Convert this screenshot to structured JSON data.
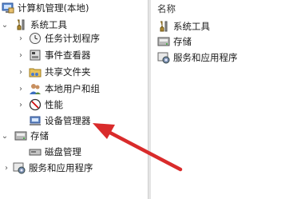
{
  "tree": {
    "root_label": "计算机管理(本地)",
    "items": [
      {
        "label": "系统工具",
        "icon": "tools-icon",
        "chevron": "expanded"
      },
      {
        "label": "任务计划程序",
        "icon": "clock-icon",
        "chevron": "collapsed"
      },
      {
        "label": "事件查看器",
        "icon": "event-viewer-icon",
        "chevron": "collapsed"
      },
      {
        "label": "共享文件夹",
        "icon": "shared-folder-icon",
        "chevron": "collapsed"
      },
      {
        "label": "本地用户和组",
        "icon": "users-icon",
        "chevron": "collapsed"
      },
      {
        "label": "性能",
        "icon": "performance-icon",
        "chevron": "collapsed"
      },
      {
        "label": "设备管理器",
        "icon": "device-manager-icon",
        "chevron": "none"
      },
      {
        "label": "存储",
        "icon": "storage-icon",
        "chevron": "expanded",
        "selected": true
      },
      {
        "label": "磁盘管理",
        "icon": "disk-icon",
        "chevron": "none"
      },
      {
        "label": "服务和应用程序",
        "icon": "services-icon",
        "chevron": "collapsed"
      }
    ]
  },
  "list": {
    "column_header": "名称",
    "items": [
      {
        "label": "系统工具",
        "icon": "tools-icon"
      },
      {
        "label": "存储",
        "icon": "storage-icon"
      },
      {
        "label": "服务和应用程序",
        "icon": "services-icon"
      }
    ]
  },
  "colors": {
    "selection": "#cce8ff",
    "annotation_arrow": "#d92b2b"
  }
}
